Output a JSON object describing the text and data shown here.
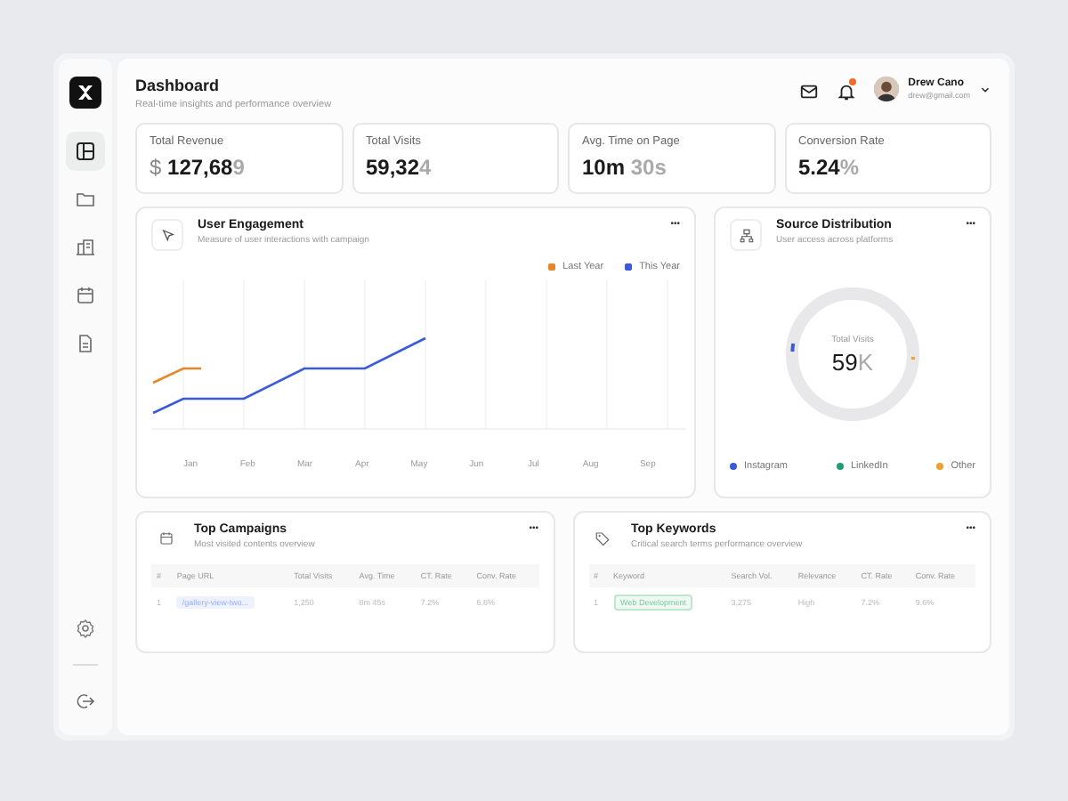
{
  "sidebar": {
    "items": [
      {
        "kind": "layout",
        "selected": true
      },
      {
        "kind": "folder",
        "selected": false
      },
      {
        "kind": "building",
        "selected": false
      },
      {
        "kind": "calendar",
        "selected": false
      },
      {
        "kind": "document",
        "selected": false
      }
    ],
    "bottom_items": [
      {
        "kind": "gear"
      },
      {
        "kind": "logout"
      }
    ]
  },
  "header": {
    "title": "Dashboard",
    "subtitle": "Real-time insights and performance overview",
    "notification_dot": true,
    "user": {
      "name": "Drew Cano",
      "email": "drew@gmail.com"
    }
  },
  "stats": [
    {
      "label": "Total Revenue",
      "prefix": "$",
      "value": "127,68",
      "faded": "9"
    },
    {
      "label": "Total Visits",
      "value": "59,32",
      "faded": "4"
    },
    {
      "label": "Avg. Time on Page",
      "value": "10m",
      "faded": " 30s"
    },
    {
      "label": "Conversion Rate",
      "value": "5.24",
      "faded": "%"
    }
  ],
  "engagement": {
    "title": "User Engagement",
    "subtitle": "Measure of user interactions with campaign",
    "menu": "•••",
    "legend": [
      {
        "label": "Last Year",
        "color": "#e8862a"
      },
      {
        "label": "This Year",
        "color": "#3a5bd9"
      }
    ],
    "months": [
      "Jan",
      "Feb",
      "Mar",
      "Apr",
      "May",
      "Jun",
      "Jul",
      "Aug",
      "Sep"
    ]
  },
  "source": {
    "title": "Source Distribution",
    "subtitle": "User access across platforms",
    "menu": "•••",
    "center_label": "Total Visits",
    "center_value": "59",
    "center_faded": "K",
    "legend": [
      {
        "label": "Instagram",
        "color": "#3a5bd9"
      },
      {
        "label": "LinkedIn",
        "color": "#1f9e6e"
      },
      {
        "label": "Other",
        "color": "#f0a030"
      }
    ]
  },
  "tables": [
    {
      "kind": "calendar",
      "title": "Top Campaigns",
      "subtitle": "Most visited contents overview",
      "menu": "•••",
      "columns": [
        "#",
        "Page URL",
        "Total Visits",
        "Avg. Time",
        "CT. Rate",
        "Conv. Rate"
      ],
      "rows": [
        {
          "cells": [
            "1",
            "/gallery-view-two...",
            "1,250",
            "8m 45s",
            "7.2%",
            "6.6%"
          ],
          "kind": "link"
        }
      ]
    },
    {
      "kind": "tag",
      "title": "Top Keywords",
      "subtitle": "Critical search terms performance overview",
      "menu": "•••",
      "columns": [
        "#",
        "Keyword",
        "Search Vol.",
        "Relevance",
        "CT. Rate",
        "Conv. Rate"
      ],
      "rows": [
        {
          "cells": [
            "1",
            "Web Development",
            "3,275",
            "High",
            "7.2%",
            "9.6%"
          ],
          "kind": "tag"
        }
      ]
    }
  ]
}
